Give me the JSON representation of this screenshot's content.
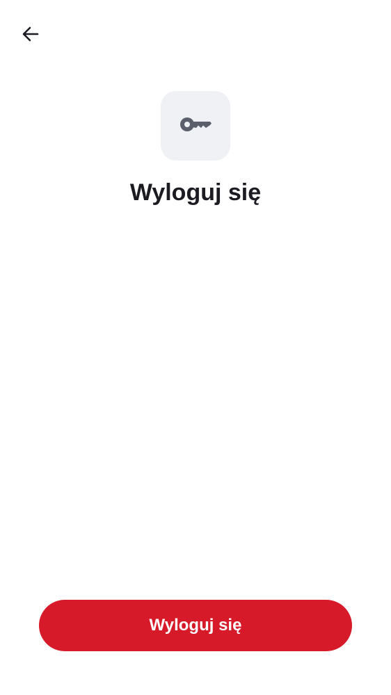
{
  "header": {
    "back_icon": "arrow-left-icon"
  },
  "main": {
    "icon": "key-icon",
    "title": "Wyloguj się"
  },
  "footer": {
    "logout_label": "Wyloguj się"
  },
  "colors": {
    "accent": "#d71a2a",
    "icon_tile_bg": "#f0f1f5",
    "icon_color": "#5b5f6b",
    "text": "#1c1b22"
  }
}
